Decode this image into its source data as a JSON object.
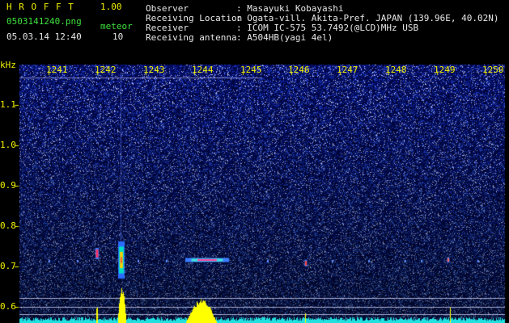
{
  "header": {
    "app_name": "H R O F F T",
    "version": "1.00",
    "filename": "0503141240.png",
    "datetime": "05.03.14 12:40",
    "meteor_label": "meteor",
    "meteor_count": "10",
    "info": [
      {
        "label": "Observer",
        "value": ": Masayuki Kobayashi"
      },
      {
        "label": "Receiving Location",
        "value": ": Ogata-vill. Akita-Pref. JAPAN (139.96E, 40.02N)"
      },
      {
        "label": "Receiver",
        "value": ": ICOM IC-575 53.7492(@LCD)MHz USB"
      },
      {
        "label": "Receiving antenna",
        "value": ": A504HB(yagi 4el)"
      }
    ]
  },
  "axis": {
    "y_unit": "kHz",
    "y_ticks": [
      "1.1",
      "1.0",
      "0.9",
      "0.8",
      "0.7",
      "0.6"
    ],
    "x_ticks": [
      "1241",
      "1242",
      "1243",
      "1244",
      "1245",
      "1246",
      "1247",
      "1248",
      "1249",
      "1250"
    ]
  },
  "colors": {
    "header_green": "#3ee03e",
    "axis_yellow": "#f0f000",
    "noise_base": "#000a60",
    "signal_yellow": "#ffff00"
  }
}
